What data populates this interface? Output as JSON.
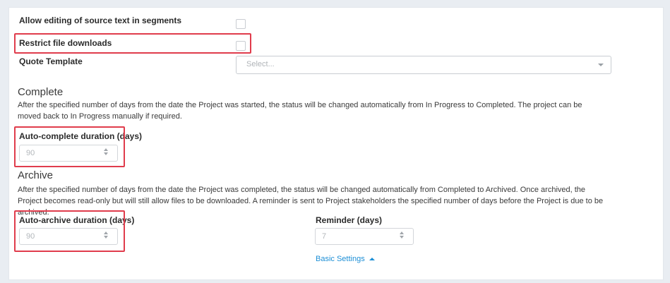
{
  "settings": {
    "allow_editing": {
      "label": "Allow editing of source text in segments",
      "checked": false
    },
    "restrict_downloads": {
      "label": "Restrict file downloads",
      "checked": false
    },
    "quote_template": {
      "label": "Quote Template",
      "placeholder": "Select..."
    }
  },
  "complete": {
    "title": "Complete",
    "description": "After the specified number of days from the date the Project was started, the status will be changed automatically from In Progress to Completed. The project can be moved back to In Progress manually if required.",
    "duration_label": "Auto-complete duration (days)",
    "duration_value": "90"
  },
  "archive": {
    "title": "Archive",
    "description": "After the specified number of days from the date the Project was completed, the status will be changed automatically from Completed to Archived. Once archived, the Project becomes read-only but will still allow files to be downloaded. A reminder is sent to Project stakeholders the specified number of days before the Project is due to be archived.",
    "duration_label": "Auto-archive duration (days)",
    "duration_value": "90",
    "reminder_label": "Reminder (days)",
    "reminder_value": "7"
  },
  "footer": {
    "basic_settings_link": "Basic Settings"
  },
  "colors": {
    "highlight": "#e03c4c",
    "link": "#1d8fd6"
  },
  "icons": {
    "select_caret": "chevron-down-icon",
    "spinner": "spin-arrows-icon",
    "link_caret": "chevron-up-icon"
  }
}
